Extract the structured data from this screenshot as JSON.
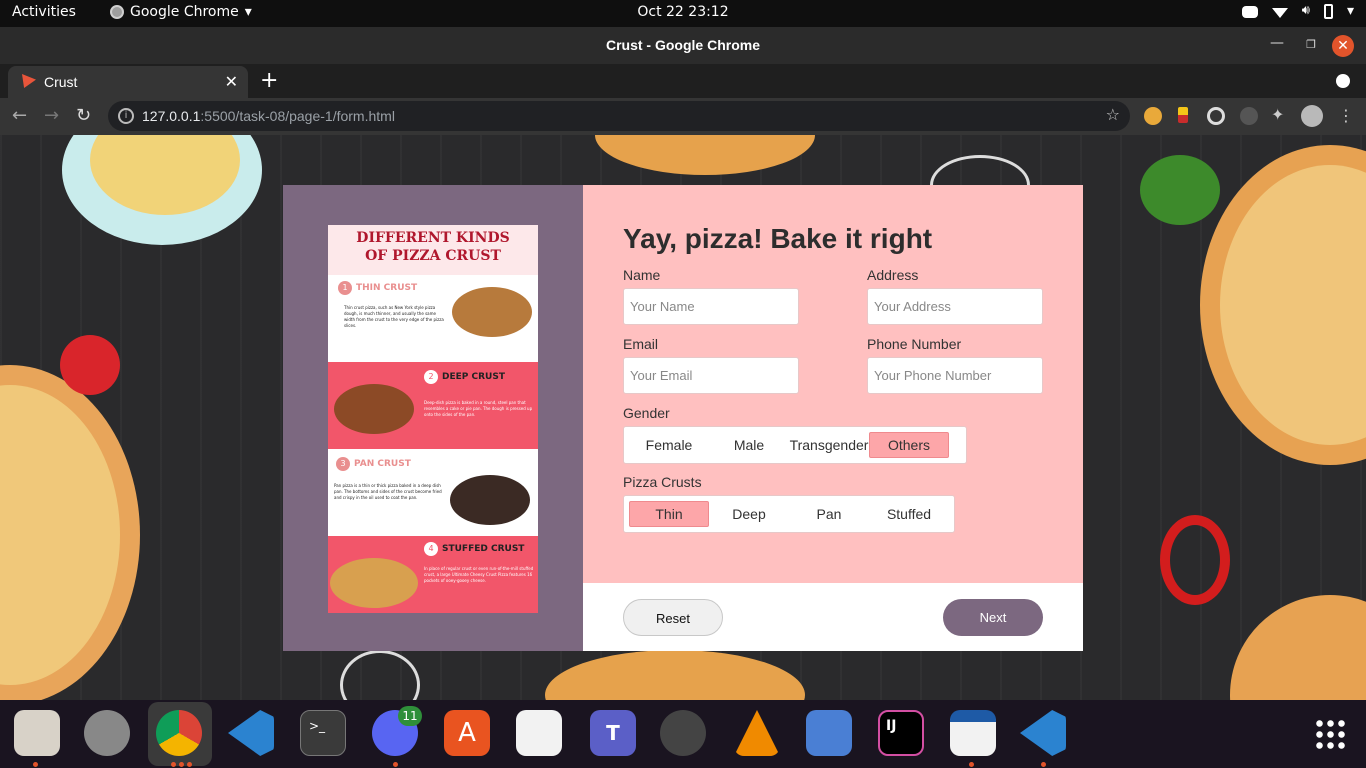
{
  "topbar": {
    "activities": "Activities",
    "app_name": "Google Chrome",
    "clock": "Oct 22  23:12"
  },
  "window": {
    "title": "Crust - Google Chrome"
  },
  "tabs": [
    {
      "label": "Crust"
    }
  ],
  "omnibox": {
    "host": "127.0.0.1",
    "path": ":5500/task-08/page-1/form.html"
  },
  "infographic": {
    "title_line1": "DIFFERENT KINDS",
    "title_line2": "OF PIZZA CRUST",
    "sections": [
      {
        "num": "1",
        "name": "THIN CRUST",
        "text": "Thin crust pizza, such as New York style pizza dough, is much thinner, and usually the same width from the crust to the very edge of the pizza slices."
      },
      {
        "num": "2",
        "name": "DEEP CRUST",
        "text": "Deep-dish pizza is baked in a round, steel pan that resembles a cake or pie pan. The dough is pressed up onto the sides of the pan."
      },
      {
        "num": "3",
        "name": "PAN CRUST",
        "text": "Pan pizza is a thin or thick pizza baked in a deep dish pan. The bottoms and sides of the crust become fried and crispy in the oil used to coat the pan."
      },
      {
        "num": "4",
        "name": "STUFFED CRUST",
        "text": "In place of regular crust or even run-of-the-mill stuffed crust, a large Ultimate Cheesy Crust Pizza features 16 pockets of ooey-gooey cheese."
      }
    ]
  },
  "form": {
    "title": "Yay, pizza! Bake it right",
    "name": {
      "label": "Name",
      "placeholder": "Your Name"
    },
    "address": {
      "label": "Address",
      "placeholder": "Your Address"
    },
    "email": {
      "label": "Email",
      "placeholder": "Your Email"
    },
    "phone": {
      "label": "Phone Number",
      "placeholder": "Your Phone Number"
    },
    "gender": {
      "label": "Gender",
      "options": [
        "Female",
        "Male",
        "Transgender",
        "Others"
      ],
      "selected": "Others"
    },
    "crusts": {
      "label": "Pizza Crusts",
      "options": [
        "Thin",
        "Deep",
        "Pan",
        "Stuffed"
      ],
      "selected": "Thin"
    },
    "reset_label": "Reset",
    "next_label": "Next"
  },
  "dock": {
    "discord_badge": "11"
  },
  "colors": {
    "panel": "#7c6880",
    "form_bg": "#ffc0c0",
    "selected": "#fda6a9"
  }
}
